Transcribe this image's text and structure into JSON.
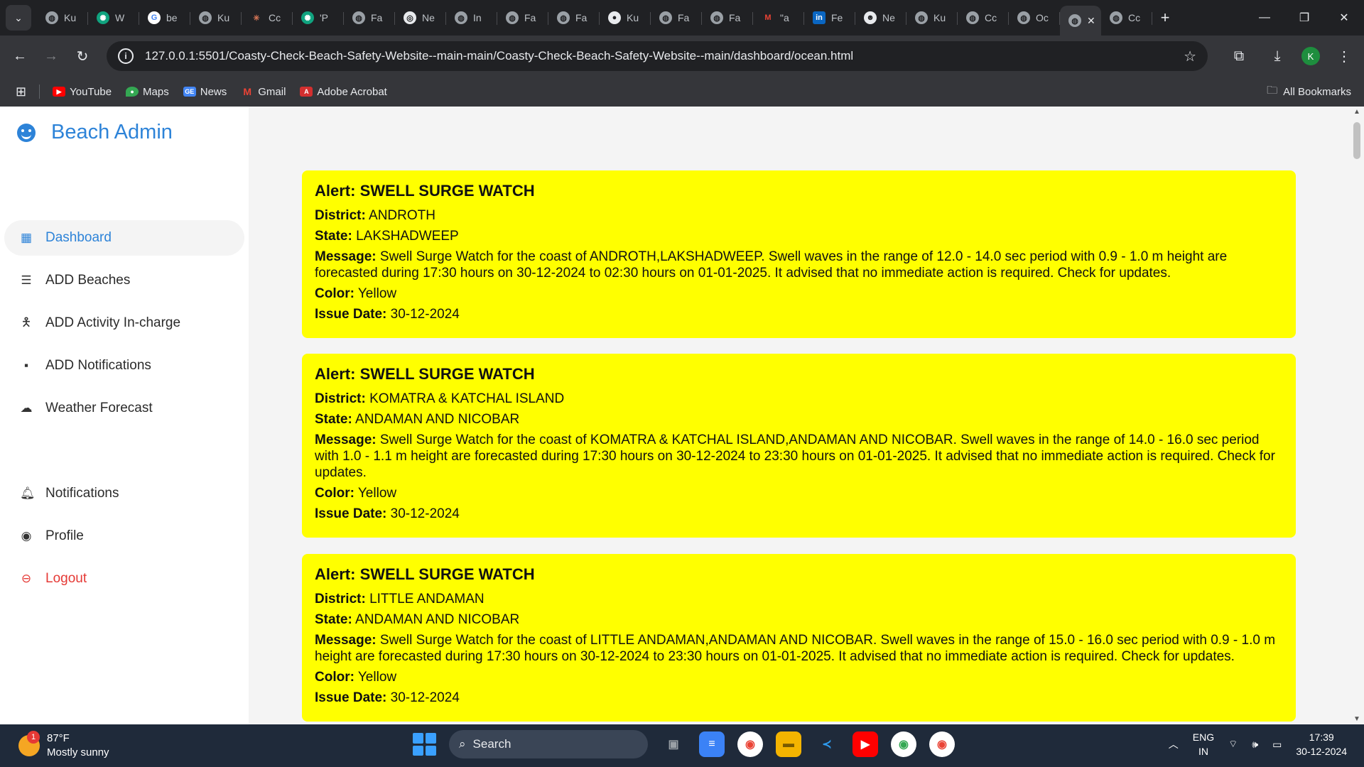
{
  "browser": {
    "tabs": [
      {
        "label": "Ku",
        "icon": "globe-icon"
      },
      {
        "label": "W",
        "icon": "chatgpt-icon"
      },
      {
        "label": "be",
        "icon": "google-icon"
      },
      {
        "label": "Ku",
        "icon": "globe-icon"
      },
      {
        "label": "Cc",
        "icon": "claude-icon"
      },
      {
        "label": "'P",
        "icon": "chatgpt-icon"
      },
      {
        "label": "Fa",
        "icon": "globe-icon"
      },
      {
        "label": "Ne",
        "icon": "globe-icon"
      },
      {
        "label": "In",
        "icon": "globe-icon"
      },
      {
        "label": "Fa",
        "icon": "globe-icon"
      },
      {
        "label": "Fa",
        "icon": "globe-icon"
      },
      {
        "label": "Ku",
        "icon": "github-icon"
      },
      {
        "label": "Fa",
        "icon": "globe-icon"
      },
      {
        "label": "Fa",
        "icon": "globe-icon"
      },
      {
        "label": "\"a",
        "icon": "gmail-icon"
      },
      {
        "label": "Fe",
        "icon": "linkedin-icon"
      },
      {
        "label": "Ne",
        "icon": "copilot-icon"
      },
      {
        "label": "Ku",
        "icon": "globe-icon"
      },
      {
        "label": "Cc",
        "icon": "globe-icon"
      },
      {
        "label": "Oc",
        "icon": "globe-icon"
      }
    ],
    "active_tab_icon": "globe-icon",
    "last_tab_label": "Cc",
    "url": "127.0.0.1:5501/Coasty-Check-Beach-Safety-Website--main-main/Coasty-Check-Beach-Safety-Website--main/dashboard/ocean.html",
    "profile_initial": "K",
    "bookmarks": [
      {
        "label": "YouTube",
        "color": "#ff0000"
      },
      {
        "label": "Maps",
        "color": "#34a853"
      },
      {
        "label": "News",
        "color": "#4285f4"
      },
      {
        "label": "Gmail",
        "color": "#ea4335"
      },
      {
        "label": "Adobe Acrobat",
        "color": "#d32f2f"
      }
    ],
    "all_bookmarks_label": "All Bookmarks"
  },
  "sidebar": {
    "brand": "Beach Admin",
    "brand_color": "#2d83d8",
    "menu": [
      {
        "label": "Dashboard",
        "icon": "grid-icon",
        "active": true
      },
      {
        "label": "ADD Beaches",
        "icon": "list-icon"
      },
      {
        "label": "ADD Activity In-charge",
        "icon": "person-icon"
      },
      {
        "label": "ADD Notifications",
        "icon": "comment-icon"
      },
      {
        "label": "Weather Forecast",
        "icon": "cloud-icon"
      }
    ],
    "lower_menu": [
      {
        "label": "Notifications",
        "icon": "bell-icon"
      },
      {
        "label": "Profile",
        "icon": "user-circle-icon"
      },
      {
        "label": "Logout",
        "icon": "logout-icon"
      }
    ]
  },
  "alerts_labels": {
    "alert": "Alert:",
    "district": "District:",
    "state": "State:",
    "message": "Message:",
    "color": "Color:",
    "issue_date": "Issue Date:"
  },
  "alerts": [
    {
      "title": "SWELL SURGE WATCH",
      "district": "ANDROTH",
      "state": "LAKSHADWEEP",
      "message": "Swell Surge Watch for the coast of ANDROTH,LAKSHADWEEP. Swell waves in the range of 12.0 - 14.0 sec period with 0.9 - 1.0 m height are forecasted during 17:30 hours on 30-12-2024 to 02:30 hours on 01-01-2025. It advised that no immediate action is required. Check for updates.",
      "color": "Yellow",
      "issue_date": "30-12-2024"
    },
    {
      "title": "SWELL SURGE WATCH",
      "district": "KOMATRA & KATCHAL ISLAND",
      "state": "ANDAMAN AND NICOBAR",
      "message": "Swell Surge Watch for the coast of KOMATRA & KATCHAL ISLAND,ANDAMAN AND NICOBAR. Swell waves in the range of 14.0 - 16.0 sec period with 1.0 - 1.1 m height are forecasted during 17:30 hours on 30-12-2024 to 23:30 hours on 01-01-2025. It advised that no immediate action is required. Check for updates.",
      "color": "Yellow",
      "issue_date": "30-12-2024"
    },
    {
      "title": "SWELL SURGE WATCH",
      "district": "LITTLE ANDAMAN",
      "state": "ANDAMAN AND NICOBAR",
      "message": "Swell Surge Watch for the coast of LITTLE ANDAMAN,ANDAMAN AND NICOBAR. Swell waves in the range of 15.0 - 16.0 sec period with 0.9 - 1.0 m height are forecasted during 17:30 hours on 30-12-2024 to 23:30 hours on 01-01-2025. It advised that no immediate action is required. Check for updates.",
      "color": "Yellow",
      "issue_date": "30-12-2024"
    }
  ],
  "alert_bg_color": "#ffff00",
  "taskbar": {
    "temperature": "87°F",
    "condition": "Mostly sunny",
    "weather_badge": "1",
    "search_label": "Search",
    "lang_top": "ENG",
    "lang_bottom": "IN",
    "time": "17:39",
    "date": "30-12-2024"
  }
}
